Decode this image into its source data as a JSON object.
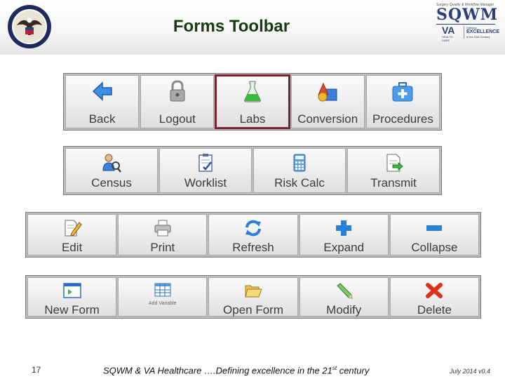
{
  "header": {
    "title": "Forms Toolbar",
    "seal_icon": "va-seal-icon",
    "logo": {
      "tagline": "Surgery Quality & Workflow Manager",
      "name": "SQWM",
      "va": "VA",
      "va_sub": "HEALTH CARE",
      "defining": "Defining",
      "excellence": "EXCELLENCE",
      "century": "in the 21st Century"
    }
  },
  "toolbars": [
    {
      "buttons": [
        {
          "label": "Back",
          "icon": "arrow-left-icon"
        },
        {
          "label": "Logout",
          "icon": "padlock-icon"
        },
        {
          "label": "Labs",
          "icon": "flask-icon",
          "selected": true
        },
        {
          "label": "Conversion",
          "icon": "shapes-icon"
        },
        {
          "label": "Procedures",
          "icon": "medical-kit-icon"
        }
      ]
    },
    {
      "buttons": [
        {
          "label": "Census",
          "icon": "person-search-icon"
        },
        {
          "label": "Worklist",
          "icon": "clipboard-check-icon"
        },
        {
          "label": "Risk Calc",
          "icon": "calculator-icon"
        },
        {
          "label": "Transmit",
          "icon": "document-send-icon"
        }
      ]
    },
    {
      "buttons": [
        {
          "label": "Edit",
          "icon": "document-edit-icon"
        },
        {
          "label": "Print",
          "icon": "printer-icon"
        },
        {
          "label": "Refresh",
          "icon": "refresh-icon"
        },
        {
          "label": "Expand",
          "icon": "plus-icon"
        },
        {
          "label": "Collapse",
          "icon": "minus-icon"
        }
      ]
    },
    {
      "buttons": [
        {
          "label": "New Form",
          "icon": "new-form-icon"
        },
        {
          "label": "Add Variable",
          "icon": "grid-icon",
          "small": true
        },
        {
          "label": "Open Form",
          "icon": "open-folder-icon"
        },
        {
          "label": "Modify",
          "icon": "pencil-icon"
        },
        {
          "label": "Delete",
          "icon": "red-x-icon"
        }
      ]
    }
  ],
  "footer": {
    "slide_number": "17",
    "text": "SQWM & VA Healthcare ….Defining excellence in the 21",
    "text_sup": "st",
    "text_tail": " century",
    "date": "July 2014  v0.4"
  },
  "colors": {
    "title": "#1a3a14",
    "selected_outline": "#7a2233",
    "logo_blue": "#2d3f7a",
    "toolbar_bg": "#bcbcbc"
  }
}
